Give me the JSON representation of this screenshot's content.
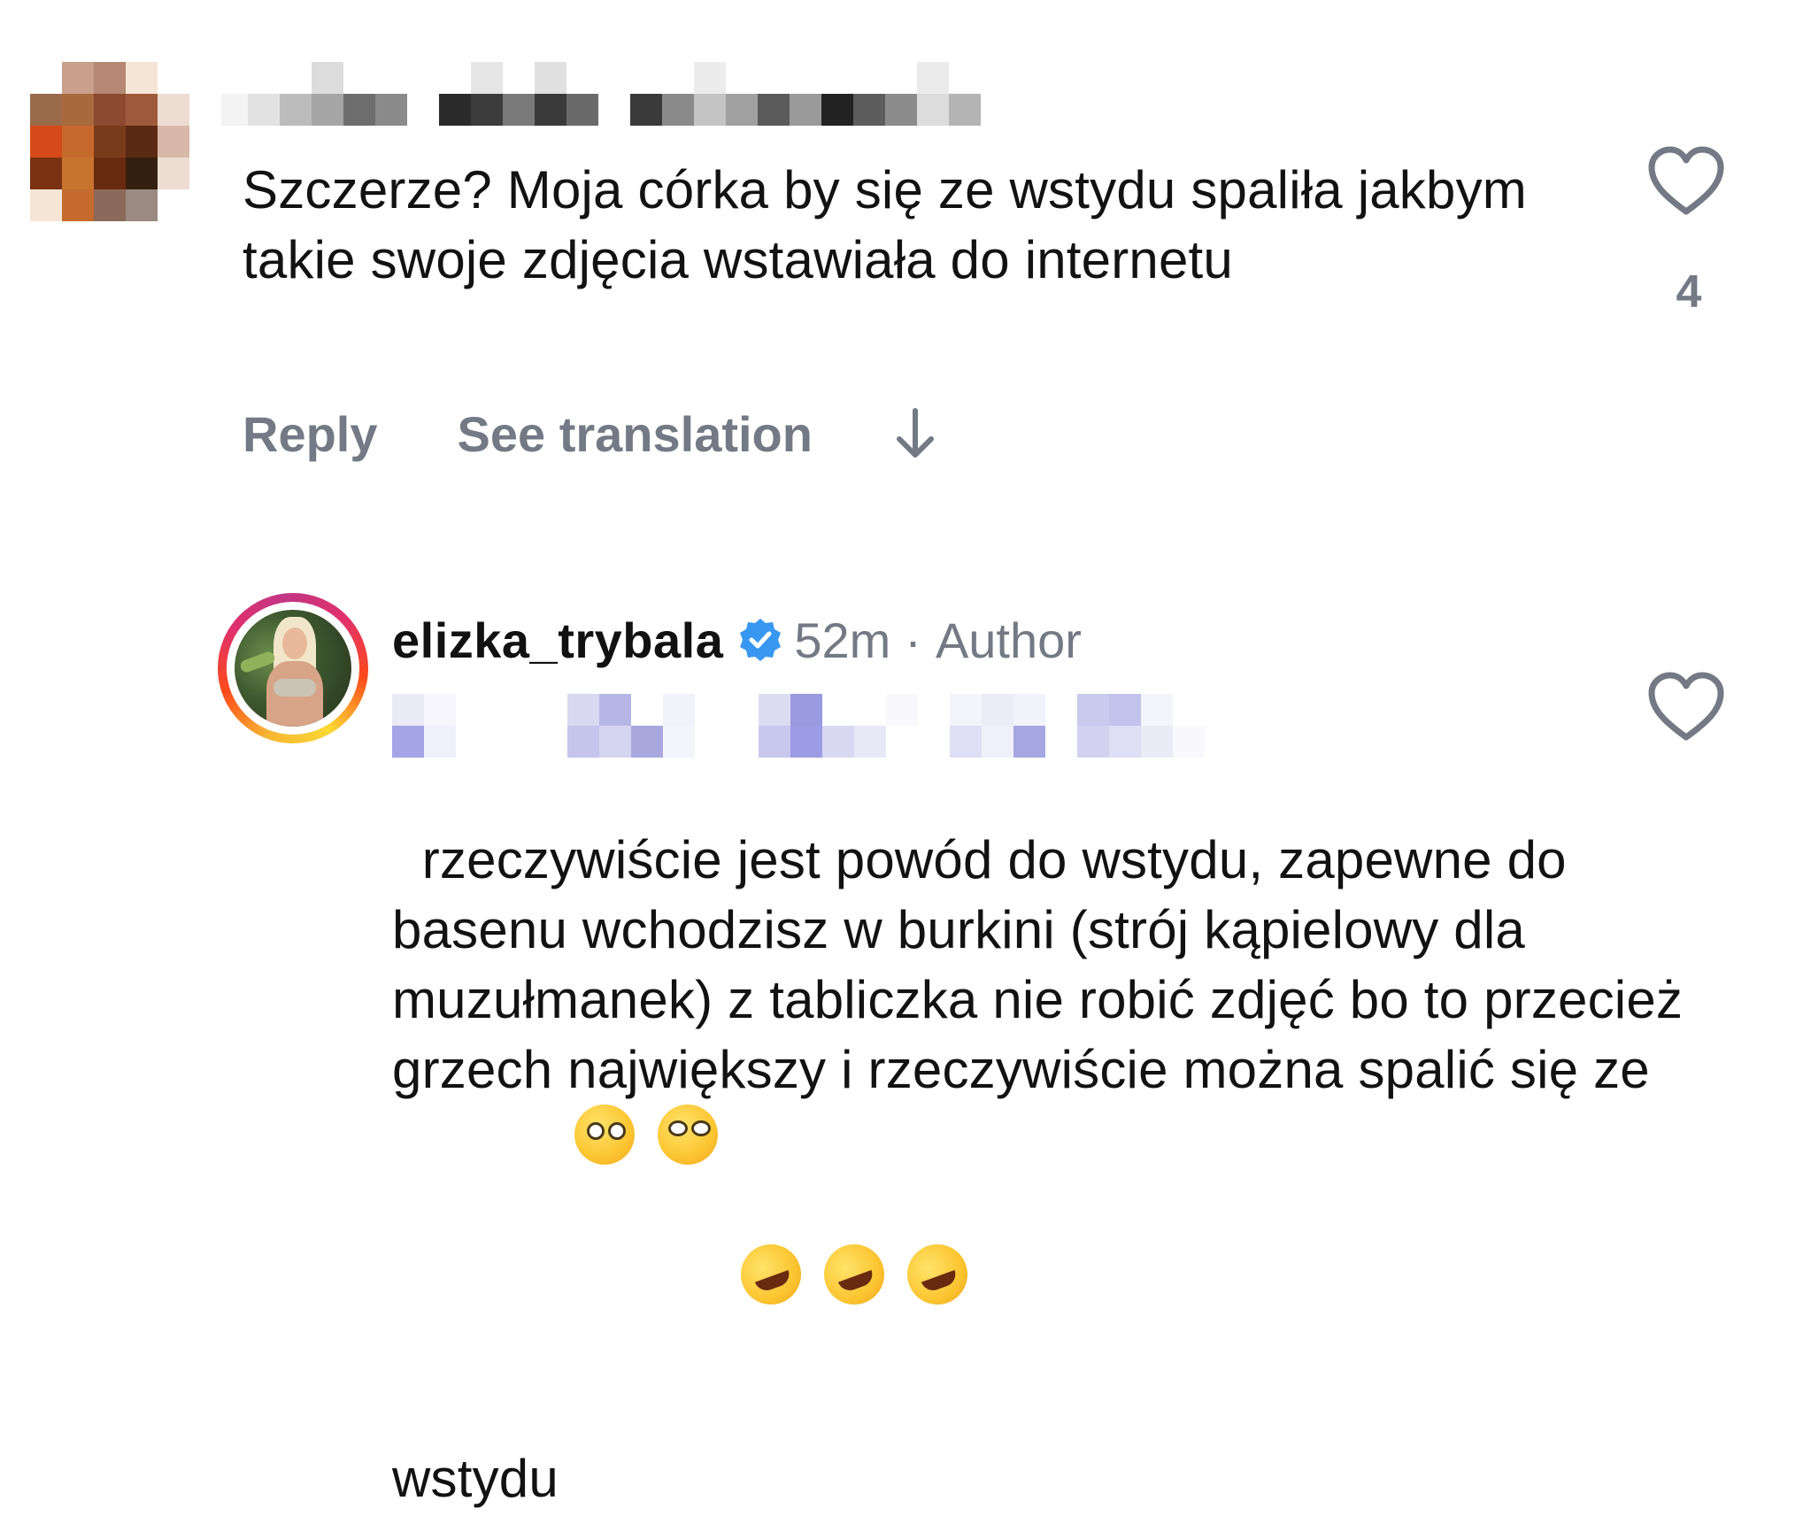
{
  "comment": {
    "username_redacted": true,
    "text": "Szczerze? Moja córka by się ze wstydu spaliła jakbym takie swoje zdjęcia wstawiała do internetu",
    "like_count": "4",
    "actions": {
      "reply": "Reply",
      "translate": "See translation"
    },
    "icons": {
      "like": "heart-icon",
      "expand": "arrow-down-icon"
    }
  },
  "reply": {
    "username": "elizka_trybala",
    "verified": true,
    "time": "52m",
    "separator": "·",
    "role": "Author",
    "mention_redacted": true,
    "text": "rzeczywiście jest powód do wstydu, zapewne do basenu wchodzisz w burkini (strój kąpielowy dla muzułmanek) z tabliczka nie robić zdjęć bo to przecież grzech największy i rzeczywiście można spalić się ze wstydu",
    "emojis": [
      "flushed-face",
      "face-with-rolling-eyes",
      "rolling-on-the-floor-laughing",
      "rolling-on-the-floor-laughing",
      "rolling-on-the-floor-laughing"
    ],
    "icons": {
      "like": "heart-icon",
      "verified": "verified-badge-icon"
    }
  },
  "colors": {
    "text": "#121212",
    "secondary": "#737985",
    "verified_blue": "#3897f0",
    "story_ring": [
      "#f7b733",
      "#fc4a1a",
      "#e1306c",
      "#c13584"
    ]
  }
}
